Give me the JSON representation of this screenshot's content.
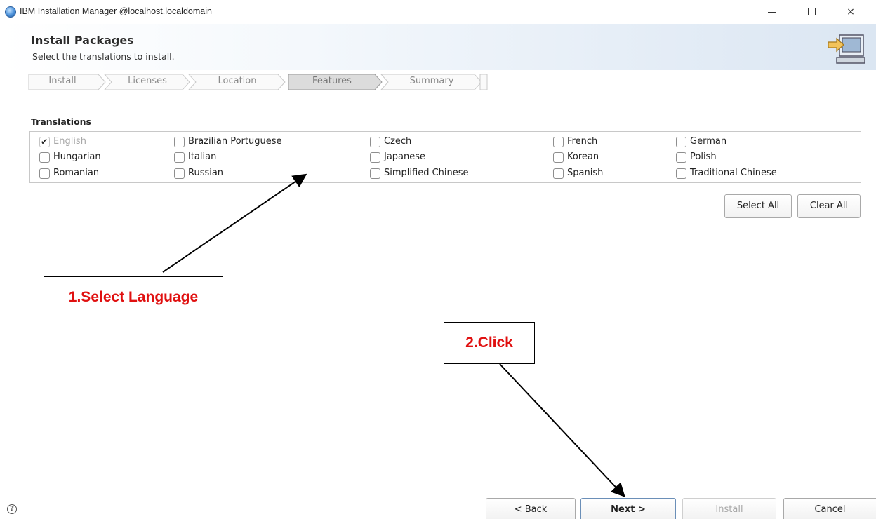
{
  "window": {
    "title": "IBM Installation Manager @localhost.localdomain",
    "controls": {
      "minimize": "minimize-icon",
      "maximize": "maximize-icon",
      "close": "×"
    }
  },
  "header": {
    "title": "Install Packages",
    "subtitle": "Select the translations to install."
  },
  "steps": [
    {
      "label": "Install",
      "active": false
    },
    {
      "label": "Licenses",
      "active": false
    },
    {
      "label": "Location",
      "active": false
    },
    {
      "label": "Features",
      "active": true
    },
    {
      "label": "Summary",
      "active": false
    }
  ],
  "translations": {
    "label": "Translations",
    "items": [
      {
        "label": "English",
        "checked": true,
        "disabled": true
      },
      {
        "label": "Brazilian Portuguese",
        "checked": false,
        "disabled": false
      },
      {
        "label": "Czech",
        "checked": false,
        "disabled": false
      },
      {
        "label": "French",
        "checked": false,
        "disabled": false
      },
      {
        "label": "German",
        "checked": false,
        "disabled": false
      },
      {
        "label": "Hungarian",
        "checked": false,
        "disabled": false
      },
      {
        "label": "Italian",
        "checked": false,
        "disabled": false
      },
      {
        "label": "Japanese",
        "checked": false,
        "disabled": false
      },
      {
        "label": "Korean",
        "checked": false,
        "disabled": false
      },
      {
        "label": "Polish",
        "checked": false,
        "disabled": false
      },
      {
        "label": "Romanian",
        "checked": false,
        "disabled": false
      },
      {
        "label": "Russian",
        "checked": false,
        "disabled": false
      },
      {
        "label": "Simplified Chinese",
        "checked": false,
        "disabled": false
      },
      {
        "label": "Spanish",
        "checked": false,
        "disabled": false
      },
      {
        "label": "Traditional Chinese",
        "checked": false,
        "disabled": false
      }
    ],
    "select_all": "Select All",
    "clear_all": "Clear All"
  },
  "annotations": {
    "step1": "1.Select Language",
    "step2": "2.Click"
  },
  "footer": {
    "help": "?",
    "back": "< Back",
    "next": "Next >",
    "install": "Install",
    "cancel": "Cancel"
  },
  "colors": {
    "annotation_text": "#e01010",
    "active_step_bg": "#dcdcdc",
    "banner_accent": "#dbe6f2"
  }
}
